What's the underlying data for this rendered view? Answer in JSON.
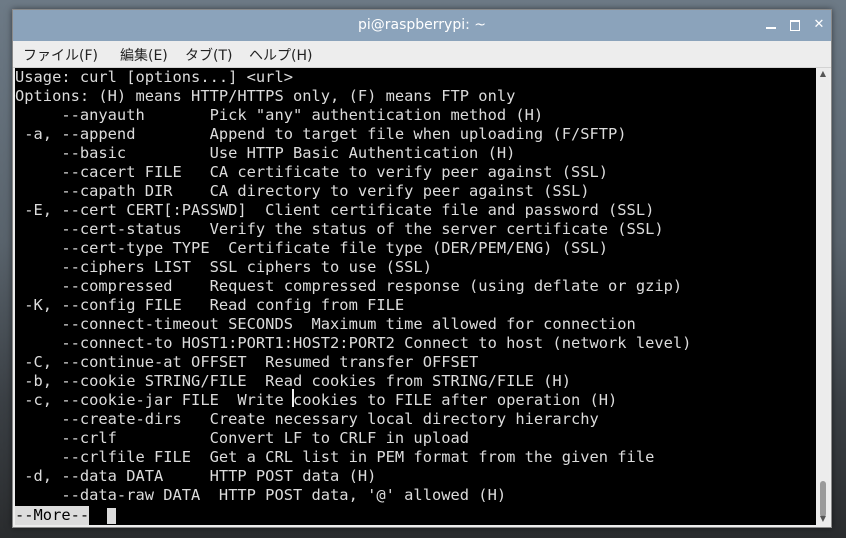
{
  "window": {
    "title": "pi@raspberrypi: ~"
  },
  "menu": [
    {
      "label": "ファイル(F)"
    },
    {
      "label": "編集(E)"
    },
    {
      "label": "タブ(T)"
    },
    {
      "label": "ヘルプ(H)"
    }
  ],
  "terminal": {
    "lines": [
      "Usage: curl [options...] <url>",
      "Options: (H) means HTTP/HTTPS only, (F) means FTP only",
      "     --anyauth       Pick \"any\" authentication method (H)",
      " -a, --append        Append to target file when uploading (F/SFTP)",
      "     --basic         Use HTTP Basic Authentication (H)",
      "     --cacert FILE   CA certificate to verify peer against (SSL)",
      "     --capath DIR    CA directory to verify peer against (SSL)",
      " -E, --cert CERT[:PASSWD]  Client certificate file and password (SSL)",
      "     --cert-status   Verify the status of the server certificate (SSL)",
      "     --cert-type TYPE  Certificate file type (DER/PEM/ENG) (SSL)",
      "     --ciphers LIST  SSL ciphers to use (SSL)",
      "     --compressed    Request compressed response (using deflate or gzip)",
      " -K, --config FILE   Read config from FILE",
      "     --connect-timeout SECONDS  Maximum time allowed for connection",
      "     --connect-to HOST1:PORT1:HOST2:PORT2 Connect to host (network level)",
      " -C, --continue-at OFFSET  Resumed transfer OFFSET",
      " -b, --cookie STRING/FILE  Read cookies from STRING/FILE (H)",
      " -c, --cookie-jar FILE  Write cookies to FILE after operation (H)",
      "     --create-dirs   Create necessary local directory hierarchy",
      "     --crlf          Convert LF to CRLF in upload",
      "     --crlfile FILE  Get a CRL list in PEM format from the given file",
      " -d, --data DATA     HTTP POST data (H)",
      "     --data-raw DATA  HTTP POST data, '@' allowed (H)"
    ],
    "pager_prompt": "--More--"
  }
}
